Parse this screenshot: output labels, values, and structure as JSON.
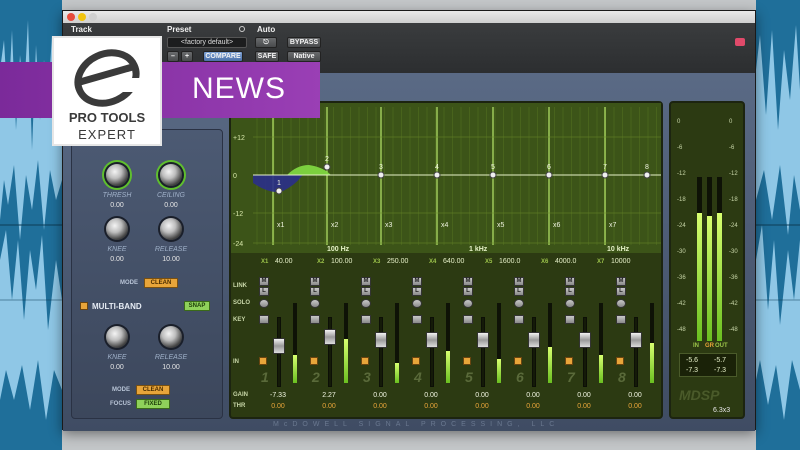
{
  "toolbar": {
    "track_label": "Track",
    "preset_label": "Preset",
    "auto_label": "Auto",
    "preset_value": "<factory default>",
    "compare_label": "COMPARE",
    "bypass_label": "BYPASS",
    "safe_label": "SAFE",
    "native_label": "Native",
    "minus_label": "–",
    "plus_label": "+"
  },
  "badge": {
    "news": "NEWS",
    "logo_line1": "PRO TOOLS",
    "logo_line2": "EXPERT"
  },
  "left_panel": {
    "thresh_label": "THRESH",
    "thresh_value": "0.00",
    "ceiling_label": "CEILING",
    "ceiling_value": "0.00",
    "knee_label": "KNEE",
    "knee_value": "0.00",
    "release_label": "RELEASE",
    "release_value": "10.00",
    "mode_label": "MODE",
    "mode_value": "CLEAN",
    "multiband_label": "MULTI-BAND",
    "snap_label": "SNAP",
    "knee2_label": "KNEE",
    "knee2_value": "0.00",
    "release2_label": "RELEASE",
    "release2_value": "10.00",
    "mode2_label": "MODE",
    "mode2_value": "CLEAN",
    "focus_label": "FOCUS",
    "focus_value": "FIXED"
  },
  "graph": {
    "db_ticks": [
      "+12",
      "0",
      "-12",
      "-24"
    ],
    "freq_axis": [
      "100 Hz",
      "1 kHz",
      "10 kHz"
    ],
    "node_labels": [
      "1",
      "2",
      "3",
      "4",
      "5",
      "6",
      "7",
      "8"
    ],
    "crossover_labels": [
      "x1",
      "x2",
      "x3",
      "x4",
      "x5",
      "x6",
      "x7"
    ]
  },
  "crossovers": [
    {
      "tag": "X1",
      "value": "40.00"
    },
    {
      "tag": "X2",
      "value": "100.00"
    },
    {
      "tag": "X3",
      "value": "250.00"
    },
    {
      "tag": "X4",
      "value": "640.00"
    },
    {
      "tag": "X5",
      "value": "1600.0"
    },
    {
      "tag": "X6",
      "value": "4000.0"
    },
    {
      "tag": "X7",
      "value": "10000"
    }
  ],
  "rows": {
    "link": "LINK",
    "solo": "SOLO",
    "key": "KEY",
    "in": "IN",
    "gain": "GAIN",
    "thr": "THR",
    "m": "M",
    "l": "L"
  },
  "bands": [
    {
      "num": "1",
      "gain": "-7.33",
      "thr": "0.00",
      "fader": 0.62,
      "meter": 0.35
    },
    {
      "num": "2",
      "gain": "2.27",
      "thr": "0.00",
      "fader": 0.78,
      "meter": 0.55
    },
    {
      "num": "3",
      "gain": "0.00",
      "thr": "0.00",
      "fader": 0.72,
      "meter": 0.25
    },
    {
      "num": "4",
      "gain": "0.00",
      "thr": "0.00",
      "fader": 0.72,
      "meter": 0.4
    },
    {
      "num": "5",
      "gain": "0.00",
      "thr": "0.00",
      "fader": 0.72,
      "meter": 0.3
    },
    {
      "num": "6",
      "gain": "0.00",
      "thr": "0.00",
      "fader": 0.72,
      "meter": 0.45
    },
    {
      "num": "7",
      "gain": "0.00",
      "thr": "0.00",
      "fader": 0.72,
      "meter": 0.35
    },
    {
      "num": "8",
      "gain": "0.00",
      "thr": "0.00",
      "fader": 0.72,
      "meter": 0.5
    }
  ],
  "meters": {
    "ticks": [
      "0",
      "-6",
      "-12",
      "-18",
      "-24",
      "-30",
      "-36",
      "-42",
      "-48"
    ],
    "labels": [
      "IN",
      "GR",
      "OUT"
    ],
    "readout": [
      "-5.6",
      "-5.7",
      "-7.3",
      "-7.3"
    ],
    "in_level": 0.78,
    "gr_level": 0.76,
    "out_level": 0.78
  },
  "footer": {
    "brand": "McDOWELL SIGNAL PROCESSING, LLC",
    "logo": "MDSP",
    "version": "6.3x3"
  },
  "colors": {
    "accent_orange": "#e8a53a",
    "accent_green": "#8fd15a",
    "badge_purple": "#8a35a8",
    "screen_green": "#2c3a12"
  }
}
